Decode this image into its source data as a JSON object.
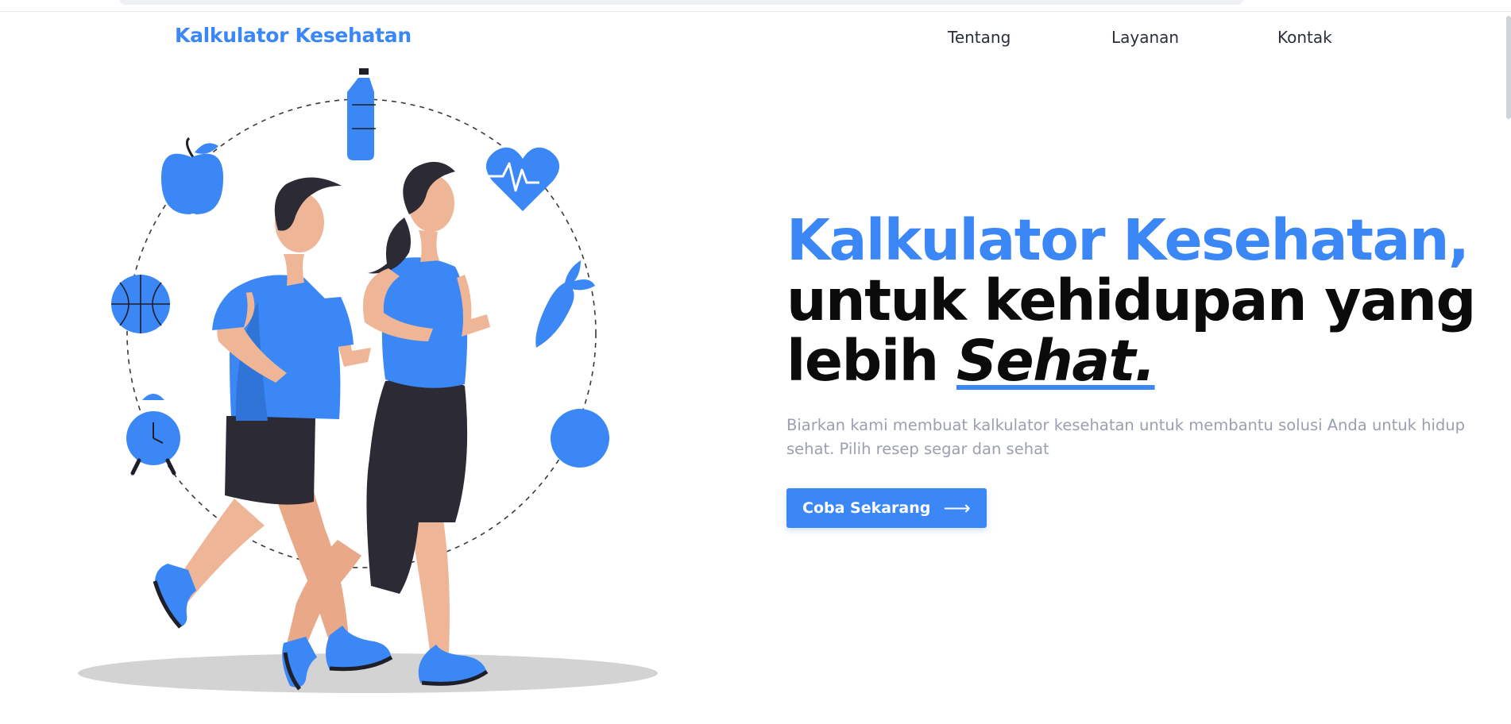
{
  "header": {
    "brand": "Kalkulator Kesehatan",
    "nav": [
      "Tentang",
      "Layanan",
      "Kontak"
    ]
  },
  "hero": {
    "title_blue": "Kalkulator Kesehatan,",
    "title_line2": "untuk kehidupan yang",
    "title_line3_prefix": "lebih",
    "title_line3_emph": "Sehat.",
    "description": "Biarkan kami membuat kalkulator kesehatan untuk membantu solusi Anda untuk hidup sehat. Pilih resep segar dan sehat",
    "cta_label": "Coba Sekarang",
    "cta_icon": "arrow-right-icon"
  },
  "illustration": {
    "icons": [
      "water-bottle-icon",
      "apple-icon",
      "heartbeat-icon",
      "basketball-icon",
      "carrot-icon",
      "alarm-clock-icon",
      "circle-icon"
    ]
  },
  "colors": {
    "accent": "#3b87f5",
    "heading": "#0b0b0b",
    "muted": "#9aa0b0",
    "skin": "#efb597",
    "dark": "#2b2a35"
  }
}
